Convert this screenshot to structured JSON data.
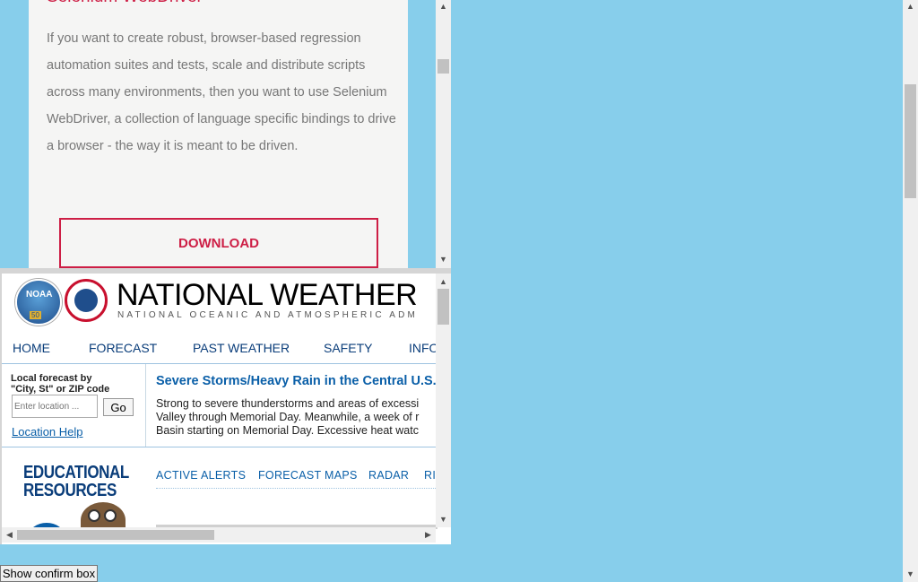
{
  "selenium": {
    "title": "Selenium WebDriver",
    "description": "If you want to create robust, browser-based regression automation suites and tests, scale and distribute scripts across many environments, then you want to use Selenium WebDriver, a collection of language specific bindings to drive a browser - the way it is meant to be driven.",
    "download_label": "DOWNLOAD"
  },
  "nws": {
    "title": "NATIONAL WEATHER",
    "subtitle": "NATIONAL OCEANIC AND ATMOSPHERIC ADM",
    "nav": [
      "HOME",
      "FORECAST",
      "PAST WEATHER",
      "SAFETY",
      "INFO"
    ],
    "local_forecast_label_1": "Local forecast by",
    "local_forecast_label_2": "\"City, St\" or ZIP code",
    "location_placeholder": "Enter location ...",
    "go_label": "Go",
    "location_help": "Location Help",
    "headline": "Severe Storms/Heavy Rain in the Central U.S.",
    "story_lines": [
      "Strong to severe thunderstorms and areas of excessi",
      "Valley through Memorial Day. Meanwhile, a week of r",
      "Basin starting on Memorial Day. Excessive heat watc"
    ],
    "edu_line1": "EDUCATIONAL",
    "edu_line2": "RESOURCES",
    "subnav": [
      "ACTIVE ALERTS",
      "FORECAST MAPS",
      "RADAR",
      "RIV"
    ]
  },
  "confirm_button_label": "Show confirm box",
  "colors": {
    "page_bg": "#87ceeb",
    "selenium_accent": "#cd1e45",
    "nws_blue": "#0a3d7a"
  }
}
